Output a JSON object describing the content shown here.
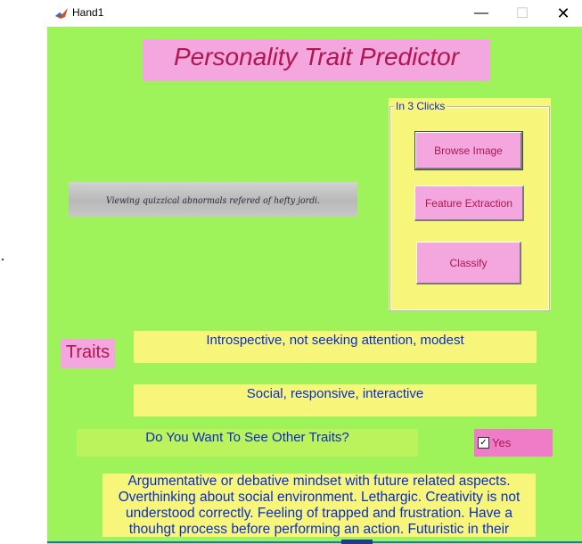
{
  "window": {
    "title": "Hand1",
    "controls": {
      "minimize": "—",
      "maximize": "☐",
      "close": "✕"
    }
  },
  "app": {
    "title": "Personality Trait Predictor",
    "panel": {
      "title": "In 3 Clicks",
      "buttons": {
        "browse": "Browse Image",
        "feature": "Feature Extraction",
        "classify": "Classify"
      }
    },
    "handwriting_sample": "Viewing quizzical abnormals refered of hefty jordi.",
    "traits_label": "Traits",
    "traits": [
      "Introspective, not seeking attention, modest",
      "Social, responsive, interactive"
    ],
    "question": "Do You Want To See Other Traits?",
    "yes_checkbox": {
      "label": "Yes",
      "checked": true,
      "mark": "✓"
    },
    "description": "Argumentative or debative mindset with future related aspects. Overthinking about social environment. Lethargic. Creativity is not understood correctly. Feeling of trapped and frustration. Have a thouhgt process before performing an action. Futuristic in their"
  },
  "colors": {
    "background": "#9ef25a",
    "pink": "#f4a6df",
    "yellow": "#f8f67a",
    "text_blue": "#0a2cc8",
    "text_red": "#b0164f"
  }
}
